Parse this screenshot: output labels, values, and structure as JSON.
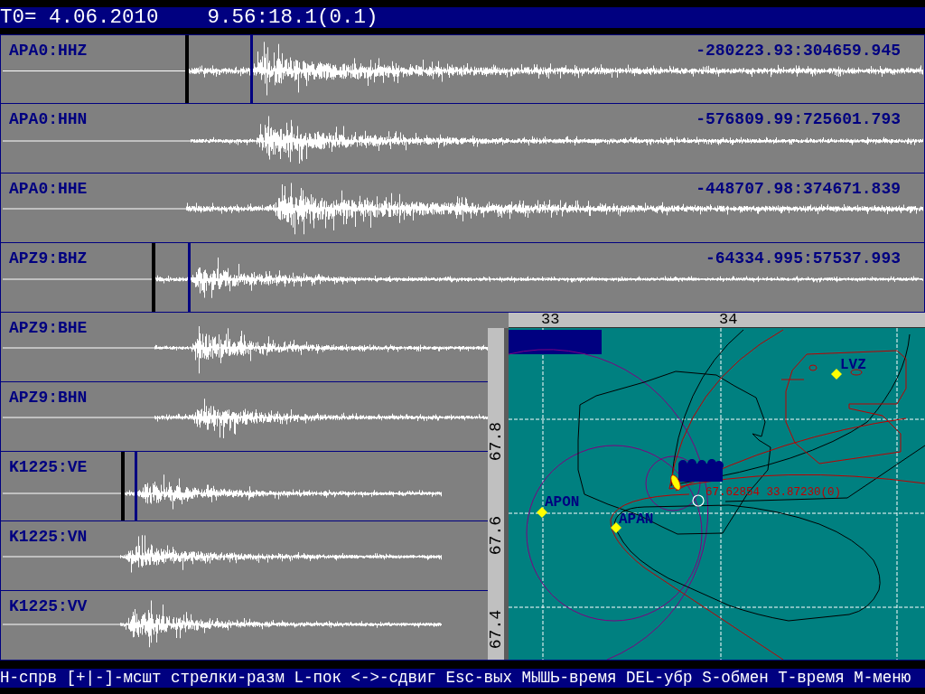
{
  "header": {
    "text": "T0= 4.06.2010    9.56:18.1(0.1)"
  },
  "traces": [
    {
      "label": "APA0:HHZ",
      "range": "-280223.93:304659.945",
      "picked": true
    },
    {
      "label": "APA0:HHN",
      "range": "-576809.99:725601.793",
      "picked": false
    },
    {
      "label": "APA0:HHE",
      "range": "-448707.98:374671.839",
      "picked": false
    },
    {
      "label": "APZ9:BHZ",
      "range": "-64334.995:57537.993",
      "picked": true
    },
    {
      "label": "APZ9:BHE",
      "picked": false
    },
    {
      "label": "APZ9:BHN",
      "picked": false
    },
    {
      "label": "K1225:VE",
      "picked": true
    },
    {
      "label": "K1225:VN",
      "picked": false
    },
    {
      "label": "K1225:VV",
      "picked": false
    }
  ],
  "map": {
    "x_ticks": [
      "33",
      "34"
    ],
    "y_ticks": [
      "67.8",
      "67.6",
      "67.4"
    ],
    "stations": [
      {
        "name": "LVZ"
      },
      {
        "name": "APON"
      },
      {
        "name": "APAN"
      }
    ],
    "event_label": "67.62854 33.87230(0)"
  },
  "status_bar": {
    "text": "H-спрв [+|-]-мсшт стрелки-разм L-пок <->-сдвиг Esc-вых МЫШЬ-время DEL-убр S-обмен T-время M-меню"
  }
}
